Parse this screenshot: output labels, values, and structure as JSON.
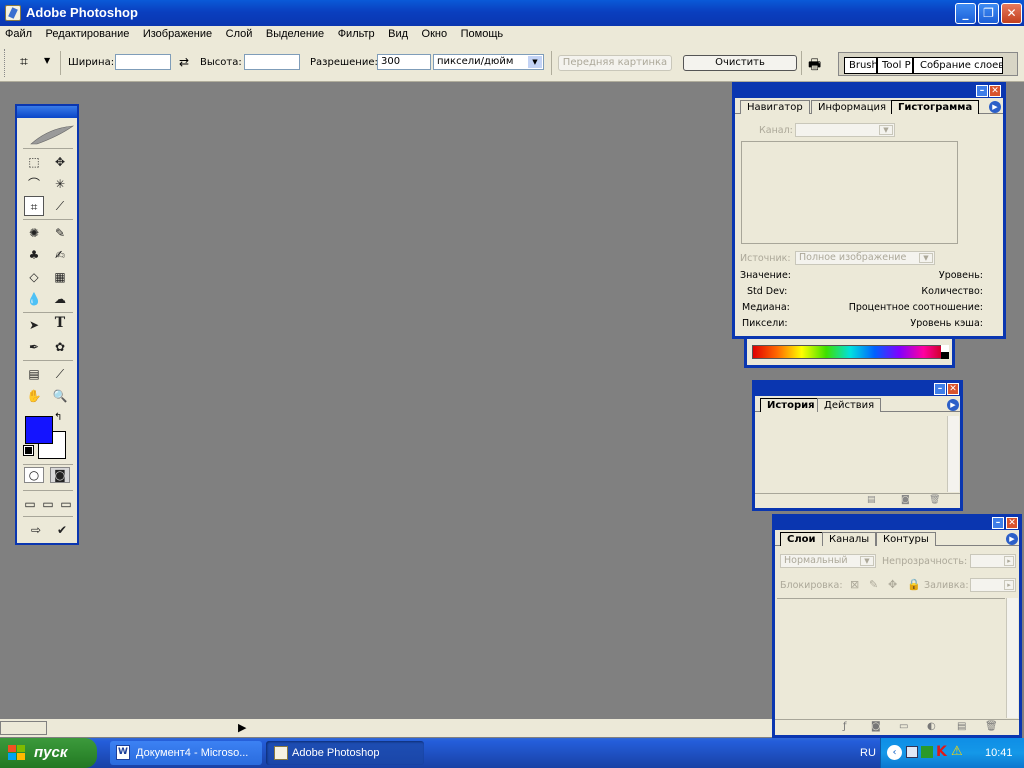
{
  "window": {
    "title": "Adobe Photoshop"
  },
  "menu": [
    "Файл",
    "Редактирование",
    "Изображение",
    "Слой",
    "Выделение",
    "Фильтр",
    "Вид",
    "Окно",
    "Помощь"
  ],
  "options_bar": {
    "width_label": "Ширина:",
    "width_value": "",
    "height_label": "Высота:",
    "height_value": "",
    "resolution_label": "Разрешение:",
    "resolution_value": "300",
    "resolution_unit": "пиксели/дюйм",
    "front_image_button": "Передняя картинка",
    "clear_button": "Очистить",
    "palette_well": [
      "Brushe",
      "Tool P",
      "Собрание слоев"
    ]
  },
  "toolbox": {
    "foreground_color": "#1414ff",
    "background_color": "#ffffff"
  },
  "histogram_panel": {
    "tabs": [
      "Навигатор",
      "Информация",
      "Гистограмма"
    ],
    "active_tab": "Гистограмма",
    "channel_label": "Канал:",
    "source_label": "Источник:",
    "source_value": "Полное изображение",
    "stats_left": [
      "Значение:",
      "Std Dev:",
      "Медиана:",
      "Пиксели:"
    ],
    "stats_right": [
      "Уровень:",
      "Количество:",
      "Процентное соотношение:",
      "Уровень кэша:"
    ]
  },
  "history_panel": {
    "tabs": [
      "История",
      "Действия"
    ],
    "active_tab": "История"
  },
  "layers_panel": {
    "tabs": [
      "Слои",
      "Каналы",
      "Контуры"
    ],
    "active_tab": "Слои",
    "blend_mode": "Нормальный",
    "opacity_label": "Непрозрачность:",
    "lock_label": "Блокировка:",
    "fill_label": "Заливка:"
  },
  "taskbar": {
    "start_label": "пуск",
    "tasks": [
      "Документ4 - Microso...",
      "Adobe Photoshop"
    ],
    "language": "RU",
    "clock": "10:41"
  }
}
